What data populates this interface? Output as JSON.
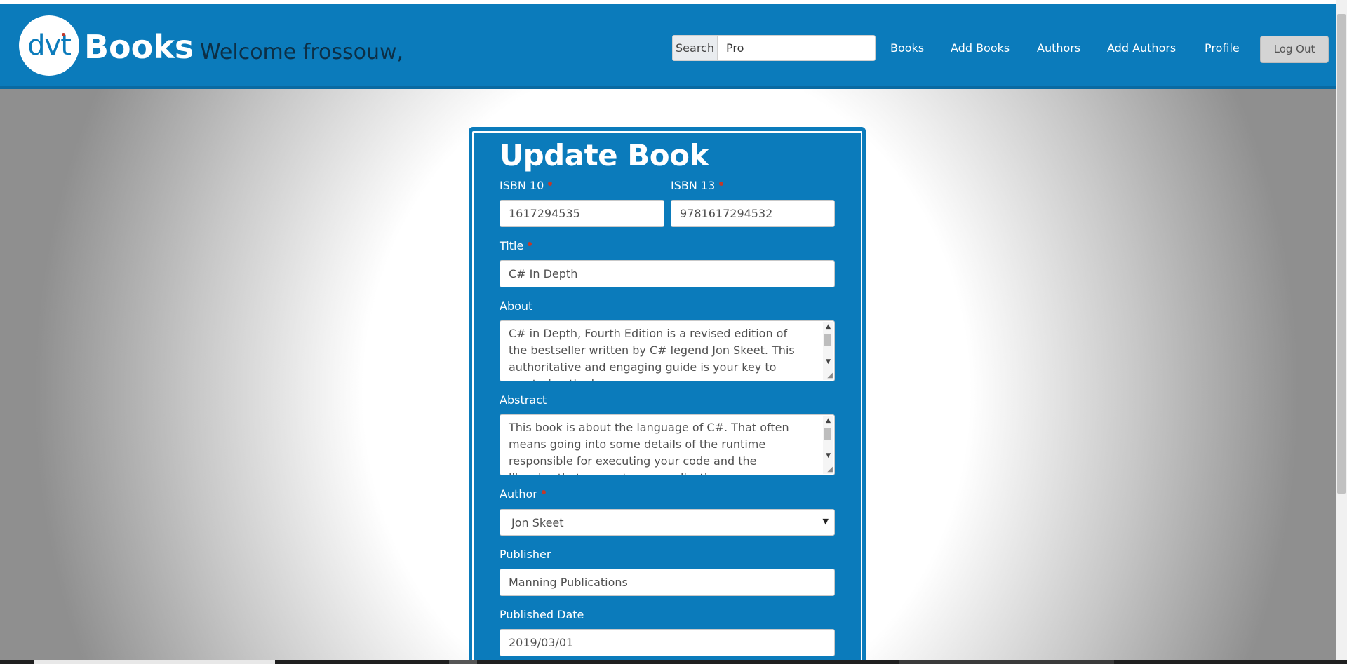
{
  "header": {
    "logo_text": "dvt",
    "brand": "Books",
    "welcome": "Welcome frossouw,",
    "search": {
      "label": "Search",
      "value": "Pro"
    },
    "nav": [
      "Books",
      "Add Books",
      "Authors",
      "Add Authors",
      "Profile"
    ],
    "logout": "Log Out"
  },
  "form": {
    "title": "Update Book",
    "isbn10": {
      "label": "ISBN 10",
      "value": "1617294535"
    },
    "isbn13": {
      "label": "ISBN 13",
      "value": "9781617294532"
    },
    "book_title": {
      "label": "Title",
      "value": "C# In Depth"
    },
    "about": {
      "label": "About",
      "value": "C# in Depth, Fourth Edition is a revised edition of the bestseller written by C# legend Jon Skeet. This authoritative and engaging guide is your key to mastering the language."
    },
    "abstract": {
      "label": "Abstract",
      "value": "This book is about the language of C#. That often means going into some details of the runtime responsible for executing your code and the libraries that support your application."
    },
    "author": {
      "label": "Author",
      "value": "Jon Skeet"
    },
    "publisher": {
      "label": "Publisher",
      "value": "Manning Publications"
    },
    "published_date": {
      "label": "Published Date",
      "value": "2019/03/01"
    }
  },
  "colors": {
    "brand_blue": "#0b7bbb",
    "required_dot": "#c0392b"
  },
  "icons": {
    "required": "required-dot-icon",
    "select_caret": "caret-down-icon",
    "scroll_up": "scroll-up-arrow-icon",
    "scroll_down": "scroll-down-arrow-icon",
    "resize": "resize-grip-icon"
  }
}
